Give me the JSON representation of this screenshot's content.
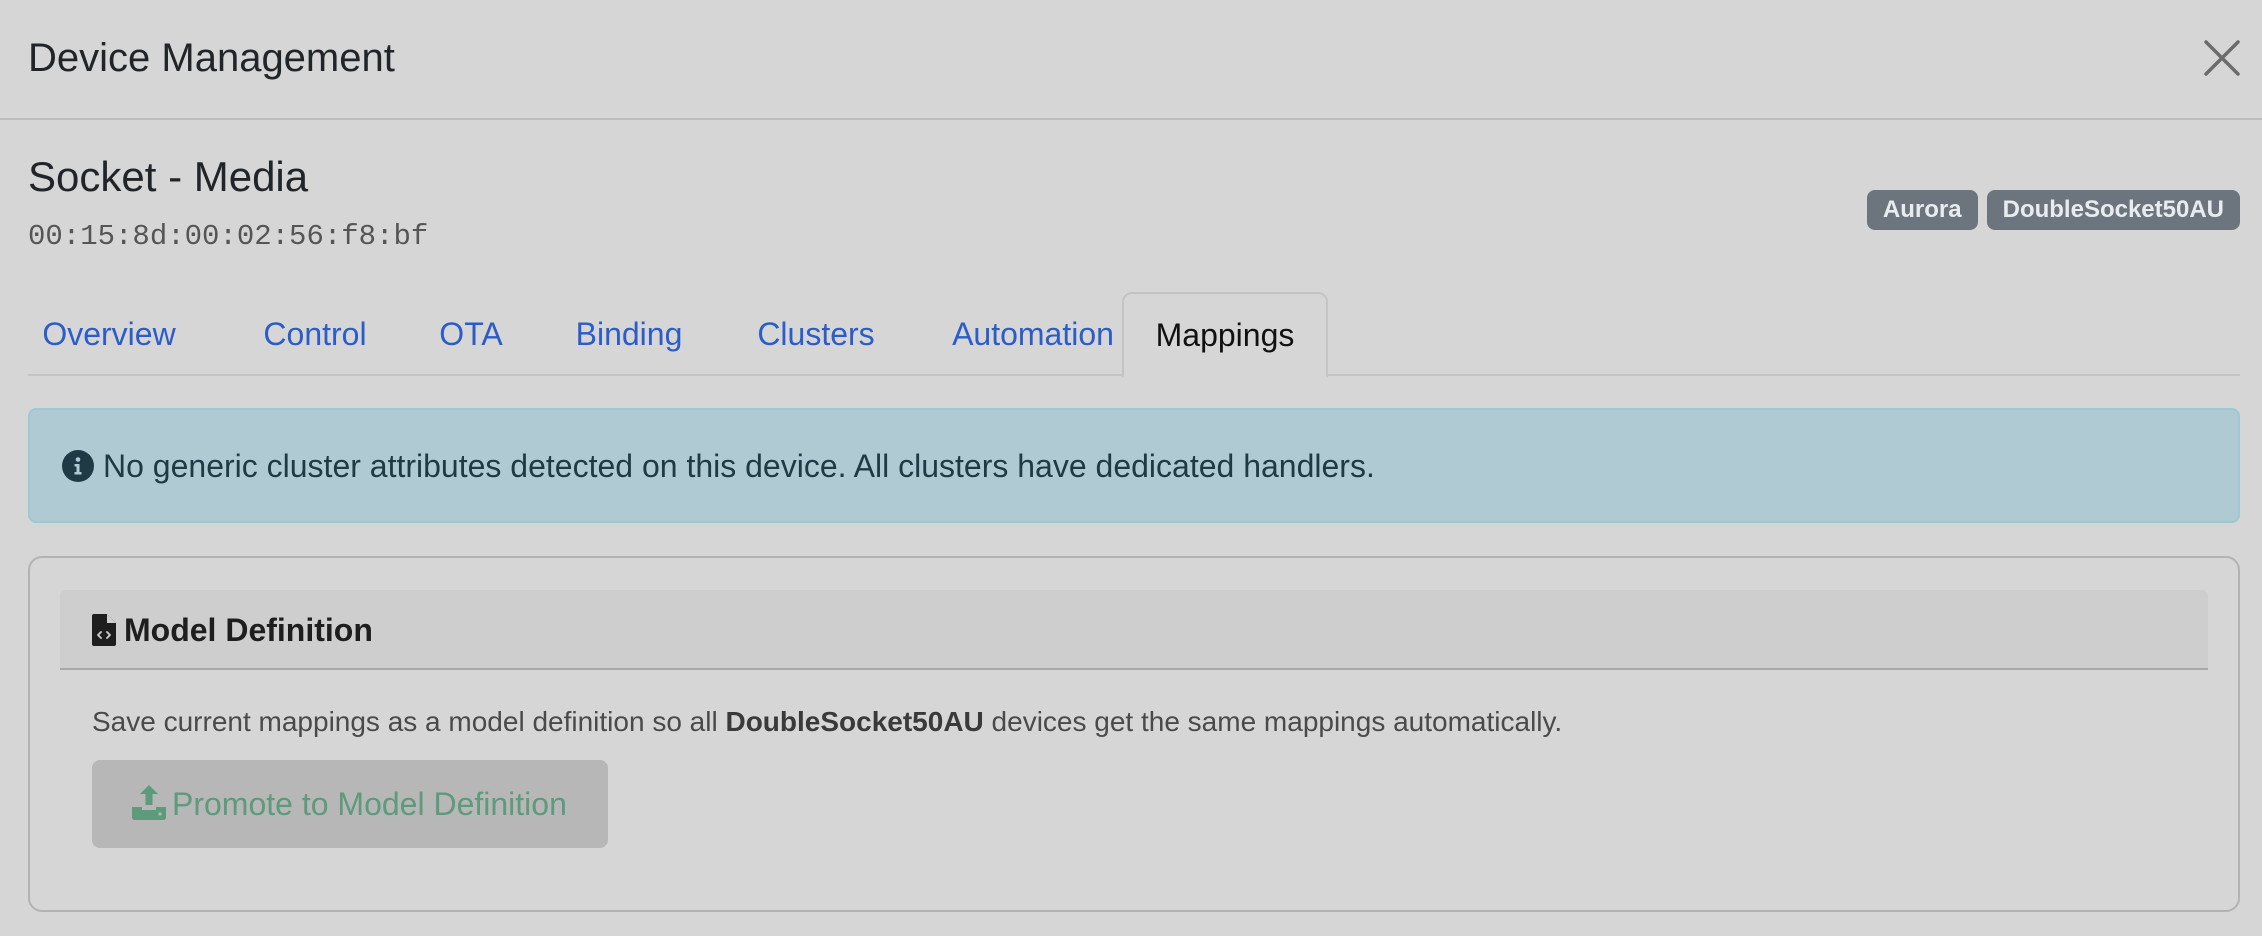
{
  "modal": {
    "title": "Device Management"
  },
  "device": {
    "name": "Socket - Media",
    "mac": "00:15:8d:00:02:56:f8:bf",
    "badges": [
      "Aurora",
      "DoubleSocket50AU"
    ]
  },
  "tabs": [
    {
      "label": "Overview"
    },
    {
      "label": "Control"
    },
    {
      "label": "OTA"
    },
    {
      "label": "Binding"
    },
    {
      "label": "Clusters"
    },
    {
      "label": "Automation"
    },
    {
      "label": "Mappings",
      "active": true
    }
  ],
  "alert": {
    "icon": "info-circle-icon",
    "text": "No generic cluster attributes detected on this device. All clusters have dedicated handlers."
  },
  "model_definition": {
    "icon": "file-code-icon",
    "title": "Model Definition",
    "description_before": "Save current mappings as a model definition so all ",
    "description_model": "DoubleSocket50AU",
    "description_after": " devices get the same mappings automatically.",
    "button_icon": "upload-icon",
    "button_label": "Promote to Model Definition"
  },
  "colors": {
    "background": "#d6d6d6",
    "link": "#2b5cc7",
    "alert_bg": "#b0cad4",
    "badge_bg": "#6c757d",
    "button_text": "#5e9a7c"
  }
}
